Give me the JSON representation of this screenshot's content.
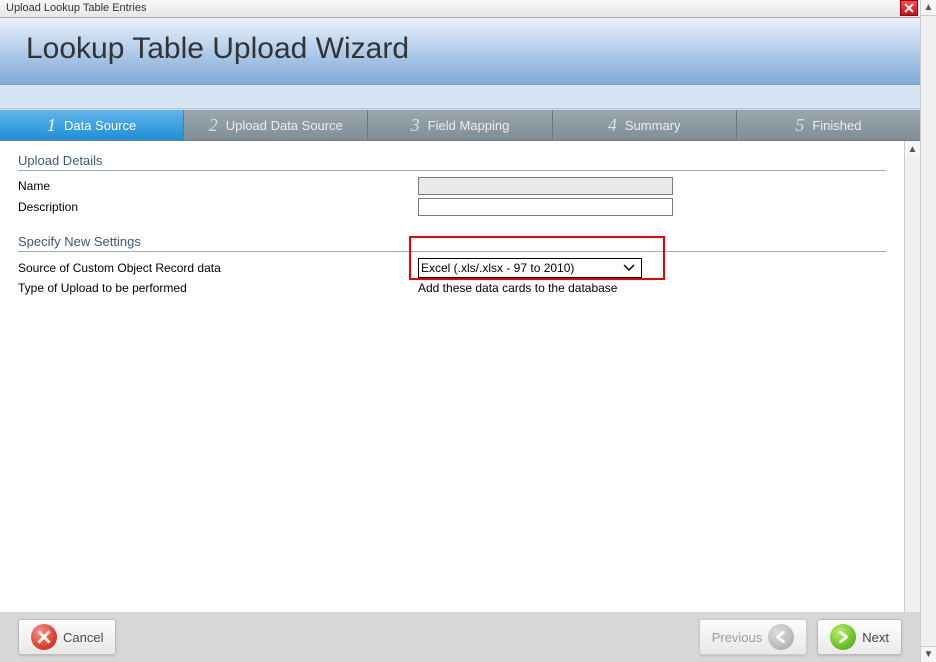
{
  "window": {
    "title": "Upload Lookup Table Entries"
  },
  "header": {
    "title": "Lookup Table Upload Wizard"
  },
  "steps": [
    {
      "num": "1",
      "label": "Data Source"
    },
    {
      "num": "2",
      "label": "Upload Data Source"
    },
    {
      "num": "3",
      "label": "Field Mapping"
    },
    {
      "num": "4",
      "label": "Summary"
    },
    {
      "num": "5",
      "label": "Finished"
    }
  ],
  "sections": {
    "upload_details": {
      "title": "Upload Details",
      "name_label": "Name",
      "name_value": "",
      "description_label": "Description",
      "description_value": ""
    },
    "settings": {
      "title": "Specify New Settings",
      "source_label": "Source of Custom Object Record data",
      "source_options": [
        "Excel (.xls/.xlsx - 97 to 2010)"
      ],
      "source_selected": "Excel (.xls/.xlsx - 97 to 2010)",
      "type_label": "Type of Upload to be performed",
      "type_value": "Add these data cards to the database"
    }
  },
  "footer": {
    "cancel": "Cancel",
    "previous": "Previous",
    "next": "Next"
  }
}
